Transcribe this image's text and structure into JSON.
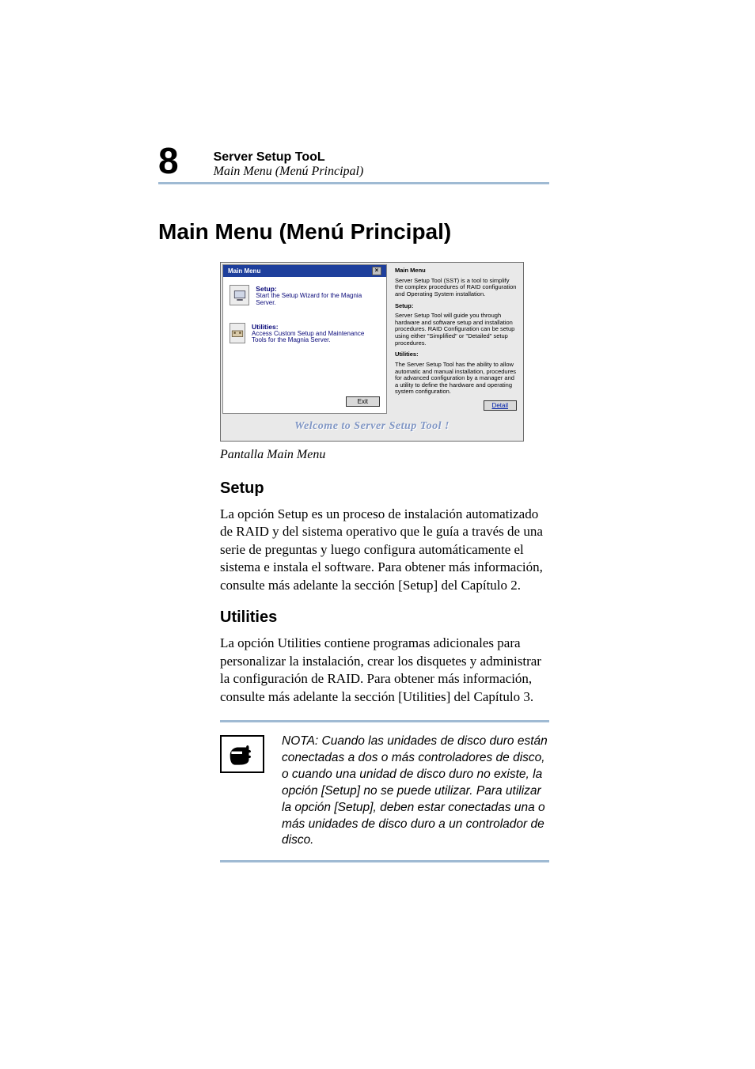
{
  "header": {
    "page_number": "8",
    "title": "Server Setup TooL",
    "subtitle": "Main Menu (Menú Principal)"
  },
  "h1": "Main Menu (Menú Principal)",
  "screenshot": {
    "window_title": "Main Menu",
    "items": [
      {
        "title": "Setup:",
        "desc": "Start the Setup Wizard for the Magnia Server."
      },
      {
        "title": "Utilities:",
        "desc": "Access Custom Setup and Maintenance Tools for the Magnia Server."
      }
    ],
    "exit_label": "Exit",
    "detail_label": "Detail",
    "right": {
      "heading": "Main Menu",
      "p1": "Server Setup Tool (SST) is a tool to simplify the complex procedures of RAID configuration and Operating System installation.",
      "h2": "Setup:",
      "p2": "Server Setup Tool will guide you through hardware and software setup and installation procedures. RAID Configuration can be setup using either \"Simplified\" or \"Detailed\" setup procedures.",
      "h3": "Utilities:",
      "p3": "The Server Setup Tool has the ability to allow automatic and manual installation, procedures for advanced configuration by a manager and a utility to define the hardware and operating system configuration."
    },
    "welcome": "Welcome to Server Setup Tool !"
  },
  "caption": "Pantalla Main Menu",
  "sections": [
    {
      "heading": "Setup",
      "body": "La opción Setup es un proceso de instalación automatizado de RAID y del sistema operativo que le guía a través de una serie de preguntas y luego configura automáticamente el sistema e instala el software. Para obtener más información, consulte más adelante la sección [Setup] del Capítulo 2."
    },
    {
      "heading": "Utilities",
      "body": "La opción Utilities contiene programas adicionales para personalizar la instalación, crear los disquetes y administrar la configuración de RAID. Para obtener más información, consulte más adelante la sección [Utilities] del Capítulo 3."
    }
  ],
  "note": "NOTA: Cuando las unidades de disco duro están conectadas a dos o más controladores de disco, o cuando una unidad de disco duro no existe, la opción [Setup] no se puede utilizar. Para utilizar la opción [Setup], deben estar conectadas una o más unidades de disco duro a un controlador de disco."
}
